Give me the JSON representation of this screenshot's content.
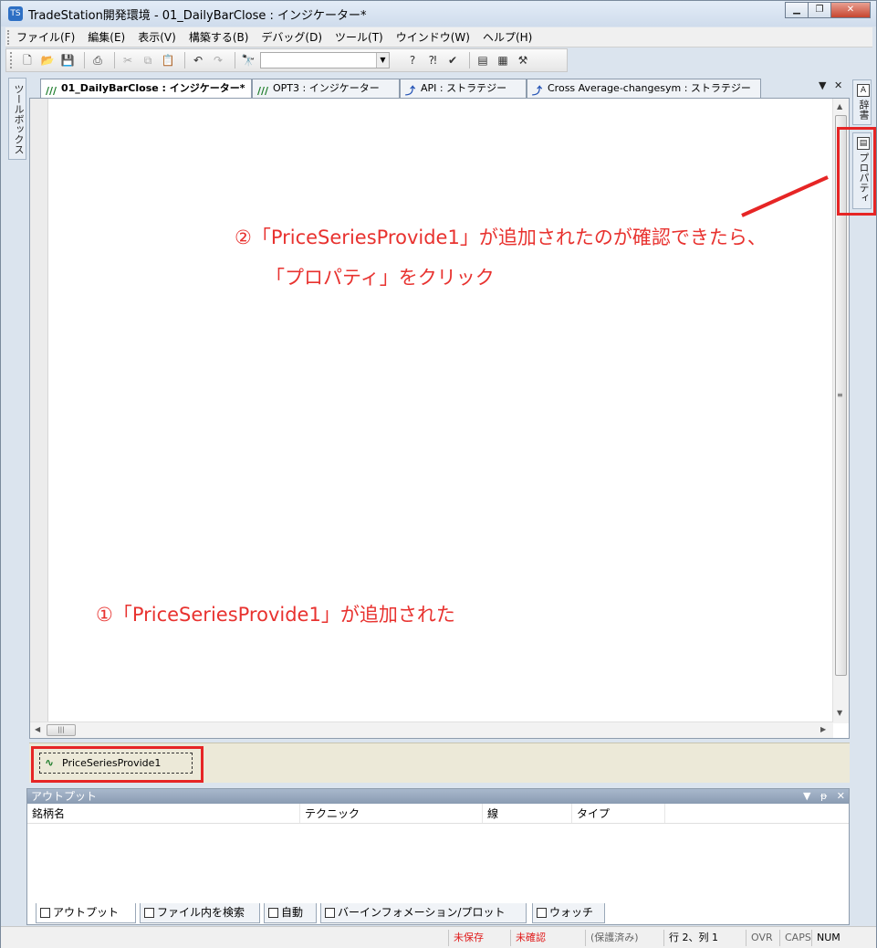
{
  "window": {
    "title": "TradeStation開発環境 - 01_DailyBarClose : インジケーター*"
  },
  "menu": [
    "ファイル(F)",
    "編集(E)",
    "表示(V)",
    "構築する(B)",
    "デバッグ(D)",
    "ツール(T)",
    "ウインドウ(W)",
    "ヘルプ(H)"
  ],
  "toolbox": {
    "label": "ツールボックス"
  },
  "side_tabs": {
    "dictionary": "辞書",
    "properties": "プロパティ"
  },
  "tabs": [
    {
      "label": "01_DailyBarClose : インジケーター*",
      "icon": "indicator-icon"
    },
    {
      "label": "OPT3 : インジケーター",
      "icon": "indicator-icon"
    },
    {
      "label": "API : ストラテジー",
      "icon": "strategy-icon"
    },
    {
      "label": "Cross Average-changesym : ストラテジー",
      "icon": "strategy-icon"
    }
  ],
  "tab_controls": {
    "menu": "▼",
    "close": "✕"
  },
  "annotations": {
    "step2_line1": "②「PriceSeriesProvide1」が追加されたのが確認できたら、",
    "step2_line2": "「プロパティ」をクリック",
    "step1": "①「PriceSeriesProvide1」が追加された"
  },
  "component": {
    "label": "PriceSeriesProvide1"
  },
  "output": {
    "title": "アウトプット",
    "controls": {
      "menu": "▼",
      "pin": "ᵽ",
      "close": "✕"
    },
    "columns": [
      "銘柄名",
      "テクニック",
      "線",
      "タイプ"
    ]
  },
  "bottom_tabs": [
    "アウトプット",
    "ファイル内を検索",
    "自動",
    "バーインフォメーション/プロット",
    "ウォッチ"
  ],
  "status": {
    "unsaved": "未保存",
    "unverified": "未確認",
    "protected": "(保護済み)",
    "position": "行 2、列 1",
    "ovr": "OVR",
    "caps": "CAPS",
    "num": "NUM"
  },
  "colors": {
    "annotation": "#e8322f",
    "highlight_box": "#e62525",
    "tray": "#ece9d8"
  }
}
